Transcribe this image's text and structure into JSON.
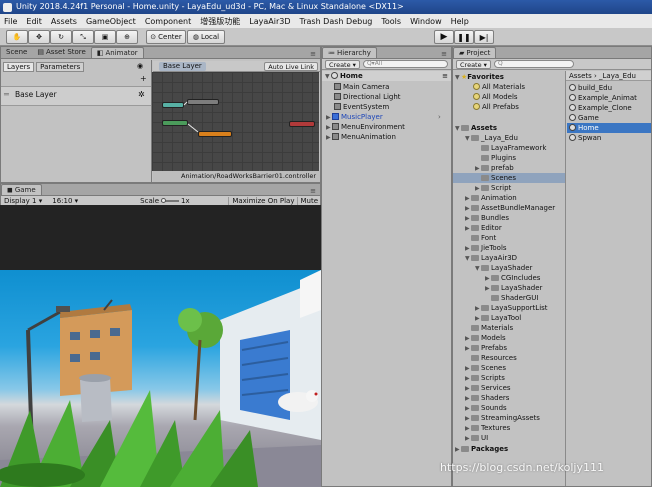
{
  "title": "Unity 2018.4.24f1 Personal - Home.unity - LayaEdu_ud3d - PC, Mac & Linux Standalone <DX11>",
  "menu": [
    "File",
    "Edit",
    "Assets",
    "GameObject",
    "Component",
    "增强版功能",
    "LayaAir3D",
    "Trash Dash Debug",
    "Tools",
    "Window",
    "Help"
  ],
  "toolbar": {
    "pivot": "Center",
    "space": "Local"
  },
  "scene_tabs": [
    "Scene",
    "Asset Store",
    "Animator"
  ],
  "animator": {
    "subtabs": [
      "Layers",
      "Parameters"
    ],
    "layer_name": "Base Layer",
    "breadcrumb": "Base Layer",
    "auto_live_link": "Auto Live Link",
    "controller_path": "Animation/RoadWorksBarrier01.controller",
    "colors": {
      "entry": "#4b9b5b",
      "any": "#57b0a4",
      "default": "#d9801c",
      "exit": "#b13a3a"
    }
  },
  "game": {
    "tab": "Game",
    "display": "Display 1",
    "aspect": "16:10",
    "scale_label": "Scale",
    "scale_value": "1x",
    "maximize": "Maximize On Play",
    "mute": "Mute"
  },
  "hierarchy": {
    "tab": "Hierarchy",
    "create": "Create",
    "search": "All",
    "scene": "Home",
    "items": [
      "Main Camera",
      "Directional Light",
      "EventSystem",
      "MusicPlayer",
      "MenuEnvironment",
      "MenuAnimation"
    ]
  },
  "project": {
    "tab": "Project",
    "create": "Create",
    "favorites_label": "Favorites",
    "favorites": [
      "All Materials",
      "All Models",
      "All Prefabs"
    ],
    "assets_label": "Assets",
    "tree": [
      {
        "label": "_Laya_Edu",
        "level": 1
      },
      {
        "label": "LayaFramework",
        "level": 2
      },
      {
        "label": "Plugins",
        "level": 2
      },
      {
        "label": "prefab",
        "level": 2
      },
      {
        "label": "Scenes",
        "level": 2
      },
      {
        "label": "Script",
        "level": 2
      },
      {
        "label": "Animation",
        "level": 1
      },
      {
        "label": "AssetBundleManager",
        "level": 1
      },
      {
        "label": "Bundles",
        "level": 1
      },
      {
        "label": "Editor",
        "level": 1
      },
      {
        "label": "Font",
        "level": 1
      },
      {
        "label": "JieTools",
        "level": 1
      },
      {
        "label": "LayaAir3D",
        "level": 1
      },
      {
        "label": "LayaShader",
        "level": 2
      },
      {
        "label": "CGIncludes",
        "level": 3
      },
      {
        "label": "LayaShader",
        "level": 3
      },
      {
        "label": "ShaderGUI",
        "level": 3
      },
      {
        "label": "LayaSupportList",
        "level": 2
      },
      {
        "label": "LayaTool",
        "level": 2
      },
      {
        "label": "Materials",
        "level": 1
      },
      {
        "label": "Models",
        "level": 1
      },
      {
        "label": "Prefabs",
        "level": 1
      },
      {
        "label": "Resources",
        "level": 1
      },
      {
        "label": "Scenes",
        "level": 1
      },
      {
        "label": "Scripts",
        "level": 1
      },
      {
        "label": "Services",
        "level": 1
      },
      {
        "label": "Shaders",
        "level": 1
      },
      {
        "label": "Sounds",
        "level": 1
      },
      {
        "label": "StreamingAssets",
        "level": 1
      },
      {
        "label": "Textures",
        "level": 1
      },
      {
        "label": "UI",
        "level": 1
      },
      {
        "label": "Packages",
        "level": 0
      }
    ],
    "breadcrumb": [
      "Assets",
      "_Laya_Edu"
    ],
    "files": [
      "build_Edu",
      "Example_Animat",
      "Example_Clone",
      "Game",
      "Home",
      "Spwan"
    ]
  },
  "watermark": "https://blog.csdn.net/koljy111"
}
